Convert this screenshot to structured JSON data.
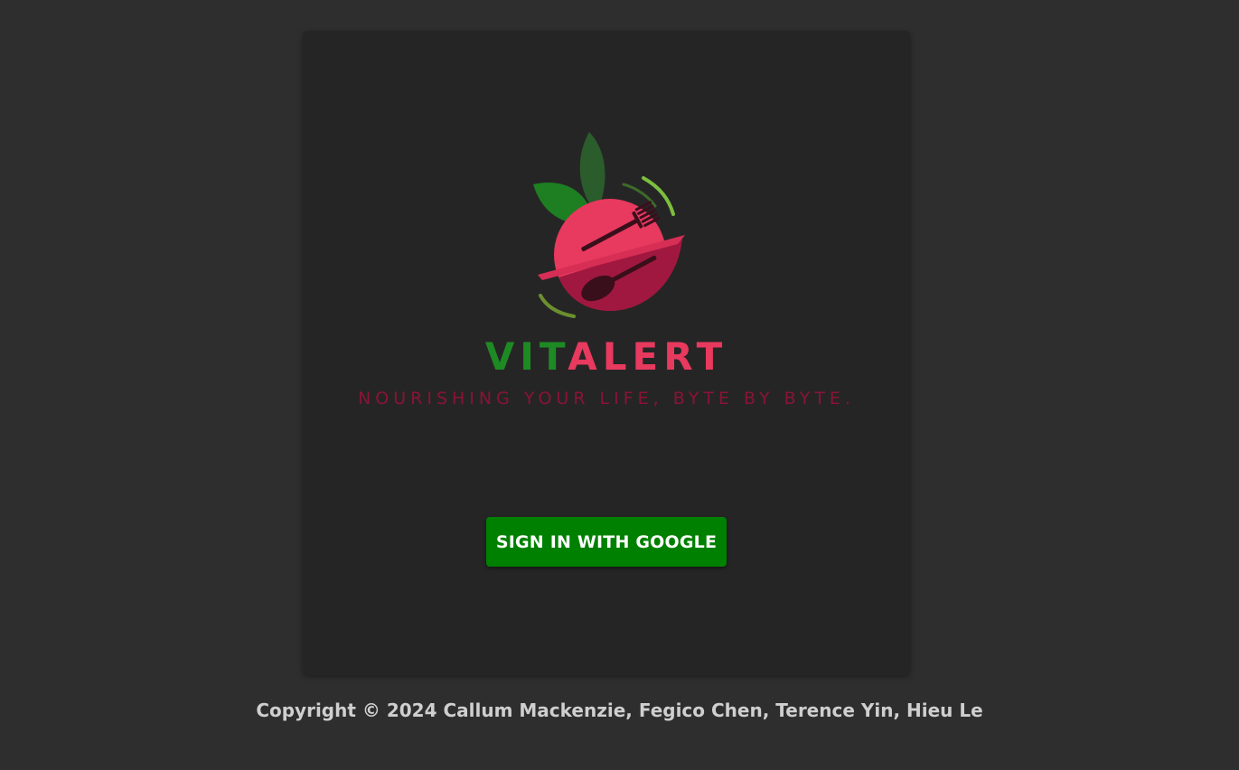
{
  "brand": {
    "name_part1": "VIT",
    "name_part2": "ALERT",
    "tagline": "NOURISHING YOUR LIFE, BYTE BY BYTE."
  },
  "signin": {
    "button_label": "SIGN IN WITH GOOGLE"
  },
  "footer": {
    "copyright": "Copyright © 2024 Callum Mackenzie, Fegico Chen, Terence Yin, Hieu Le"
  },
  "icons": {
    "logo": "apple-fork-spoon-icon"
  },
  "colors": {
    "background": "#2e2e2e",
    "card": "#262526",
    "brand_green": "#1e8a24",
    "brand_pink": "#e8395e",
    "tagline": "#8a1336",
    "button": "#008000"
  }
}
